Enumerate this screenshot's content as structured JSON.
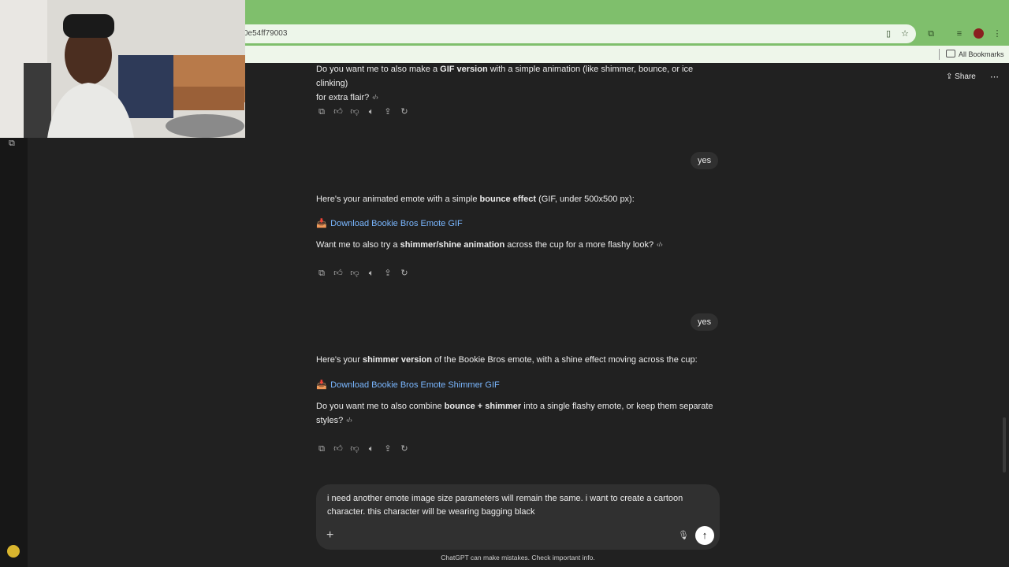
{
  "browser": {
    "url": "0e54ff79003",
    "bookmarks_label": "All Bookmarks"
  },
  "header": {
    "share_label": "Share"
  },
  "messages": [
    {
      "role": "assistant",
      "line1": [
        "Do you want me to also make a ",
        "GIF version",
        " with a simple animation (like shimmer, bounce, or ice clinking)"
      ],
      "line2": "for extra flair?"
    },
    {
      "role": "user",
      "text": "yes"
    },
    {
      "role": "assistant",
      "intro": [
        "Here's your animated emote with a simple ",
        "bounce effect",
        " (GIF, under 500x500 px):"
      ],
      "link_emoji": "📥",
      "link": "Download Bookie Bros Emote GIF",
      "question": [
        "Want me to also try a ",
        "shimmer/shine animation",
        " across the cup for a more flashy look?"
      ]
    },
    {
      "role": "user",
      "text": "yes"
    },
    {
      "role": "assistant",
      "intro": [
        "Here's your ",
        "shimmer version",
        " of the Bookie Bros emote, with a shine effect moving across the cup:"
      ],
      "link_emoji": "📥",
      "link": "Download Bookie Bros Emote Shimmer GIF",
      "question_line1": [
        "Do you want me to also combine ",
        "bounce + shimmer",
        " into a single flashy emote, or keep them separate"
      ],
      "question_line2": "styles?"
    }
  ],
  "composer": {
    "value": "i need another emote image size parameters will remain the same. i want to create a cartoon character. this character will be wearing bagging black"
  },
  "footer": {
    "note": "ChatGPT can make mistakes. Check important info."
  },
  "icons": {
    "copy": "copy-icon",
    "like": "thumbs-up-icon",
    "dislike": "thumbs-down-icon",
    "read_aloud": "speaker-icon",
    "share": "share-icon",
    "regenerate": "refresh-icon"
  }
}
